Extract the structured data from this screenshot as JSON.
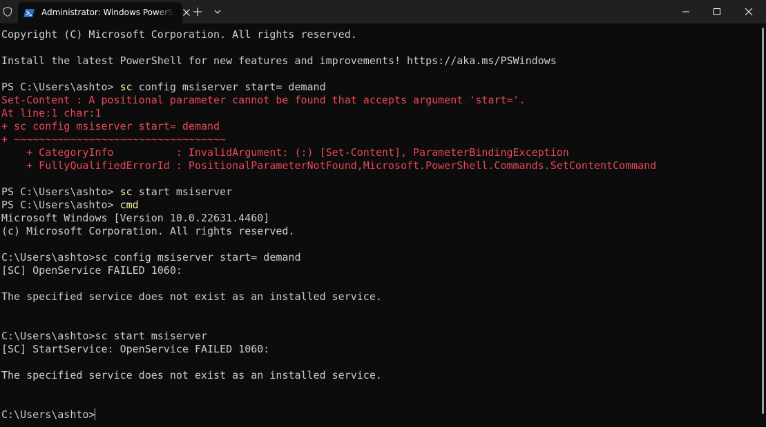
{
  "window": {
    "tab_title": "Administrator: Windows PowerShell",
    "tab_icon": "powershell-icon",
    "new_tab_icon": "plus-icon",
    "dropdown_icon": "chevron-down-icon",
    "controls": [
      "minimize-icon",
      "maximize-icon",
      "close-icon"
    ]
  },
  "colors": {
    "background": "#0c0c0c",
    "titlebar": "#202020",
    "text": "#cccccc",
    "error": "#e74856",
    "command": "#f9f1a5",
    "powershell_blue": "#2c6bc4"
  },
  "terminal": {
    "lines": [
      {
        "segments": [
          {
            "text": "Copyright (C) Microsoft Corporation. All rights reserved.",
            "style": "normal"
          }
        ]
      },
      {
        "segments": []
      },
      {
        "segments": [
          {
            "text": "Install the latest PowerShell for new features and improvements! https://aka.ms/PSWindows",
            "style": "normal"
          }
        ]
      },
      {
        "segments": []
      },
      {
        "segments": [
          {
            "text": "PS C:\\Users\\ashto> ",
            "style": "normal"
          },
          {
            "text": "sc",
            "style": "cmd"
          },
          {
            "text": " config msiserver start= demand",
            "style": "normal"
          }
        ]
      },
      {
        "segments": [
          {
            "text": "Set-Content : A positional parameter cannot be found that accepts argument 'start='.",
            "style": "err"
          }
        ]
      },
      {
        "segments": [
          {
            "text": "At line:1 char:1",
            "style": "err"
          }
        ]
      },
      {
        "segments": [
          {
            "text": "+ sc config msiserver start= demand",
            "style": "err"
          }
        ]
      },
      {
        "segments": [
          {
            "text": "+ ~~~~~~~~~~~~~~~~~~~~~~~~~~~~~~~~~~",
            "style": "err"
          }
        ]
      },
      {
        "segments": [
          {
            "text": "    + CategoryInfo          : InvalidArgument: (:) [Set-Content], ParameterBindingException",
            "style": "err"
          }
        ]
      },
      {
        "segments": [
          {
            "text": "    + FullyQualifiedErrorId : PositionalParameterNotFound,Microsoft.PowerShell.Commands.SetContentCommand",
            "style": "err"
          }
        ]
      },
      {
        "segments": []
      },
      {
        "segments": [
          {
            "text": "PS C:\\Users\\ashto> ",
            "style": "normal"
          },
          {
            "text": "sc",
            "style": "cmd"
          },
          {
            "text": " start msiserver",
            "style": "normal"
          }
        ]
      },
      {
        "segments": [
          {
            "text": "PS C:\\Users\\ashto> ",
            "style": "normal"
          },
          {
            "text": "cmd",
            "style": "cmd"
          }
        ]
      },
      {
        "segments": [
          {
            "text": "Microsoft Windows [Version 10.0.22631.4460]",
            "style": "normal"
          }
        ]
      },
      {
        "segments": [
          {
            "text": "(c) Microsoft Corporation. All rights reserved.",
            "style": "normal"
          }
        ]
      },
      {
        "segments": []
      },
      {
        "segments": [
          {
            "text": "C:\\Users\\ashto>sc config msiserver start= demand",
            "style": "normal"
          }
        ]
      },
      {
        "segments": [
          {
            "text": "[SC] OpenService FAILED 1060:",
            "style": "normal"
          }
        ]
      },
      {
        "segments": []
      },
      {
        "segments": [
          {
            "text": "The specified service does not exist as an installed service.",
            "style": "normal"
          }
        ]
      },
      {
        "segments": []
      },
      {
        "segments": []
      },
      {
        "segments": [
          {
            "text": "C:\\Users\\ashto>sc start msiserver",
            "style": "normal"
          }
        ]
      },
      {
        "segments": [
          {
            "text": "[SC] StartService: OpenService FAILED 1060:",
            "style": "normal"
          }
        ]
      },
      {
        "segments": []
      },
      {
        "segments": [
          {
            "text": "The specified service does not exist as an installed service.",
            "style": "normal"
          }
        ]
      },
      {
        "segments": []
      },
      {
        "segments": []
      },
      {
        "segments": [
          {
            "text": "C:\\Users\\ashto>",
            "style": "normal"
          }
        ],
        "cursor": true
      }
    ]
  }
}
